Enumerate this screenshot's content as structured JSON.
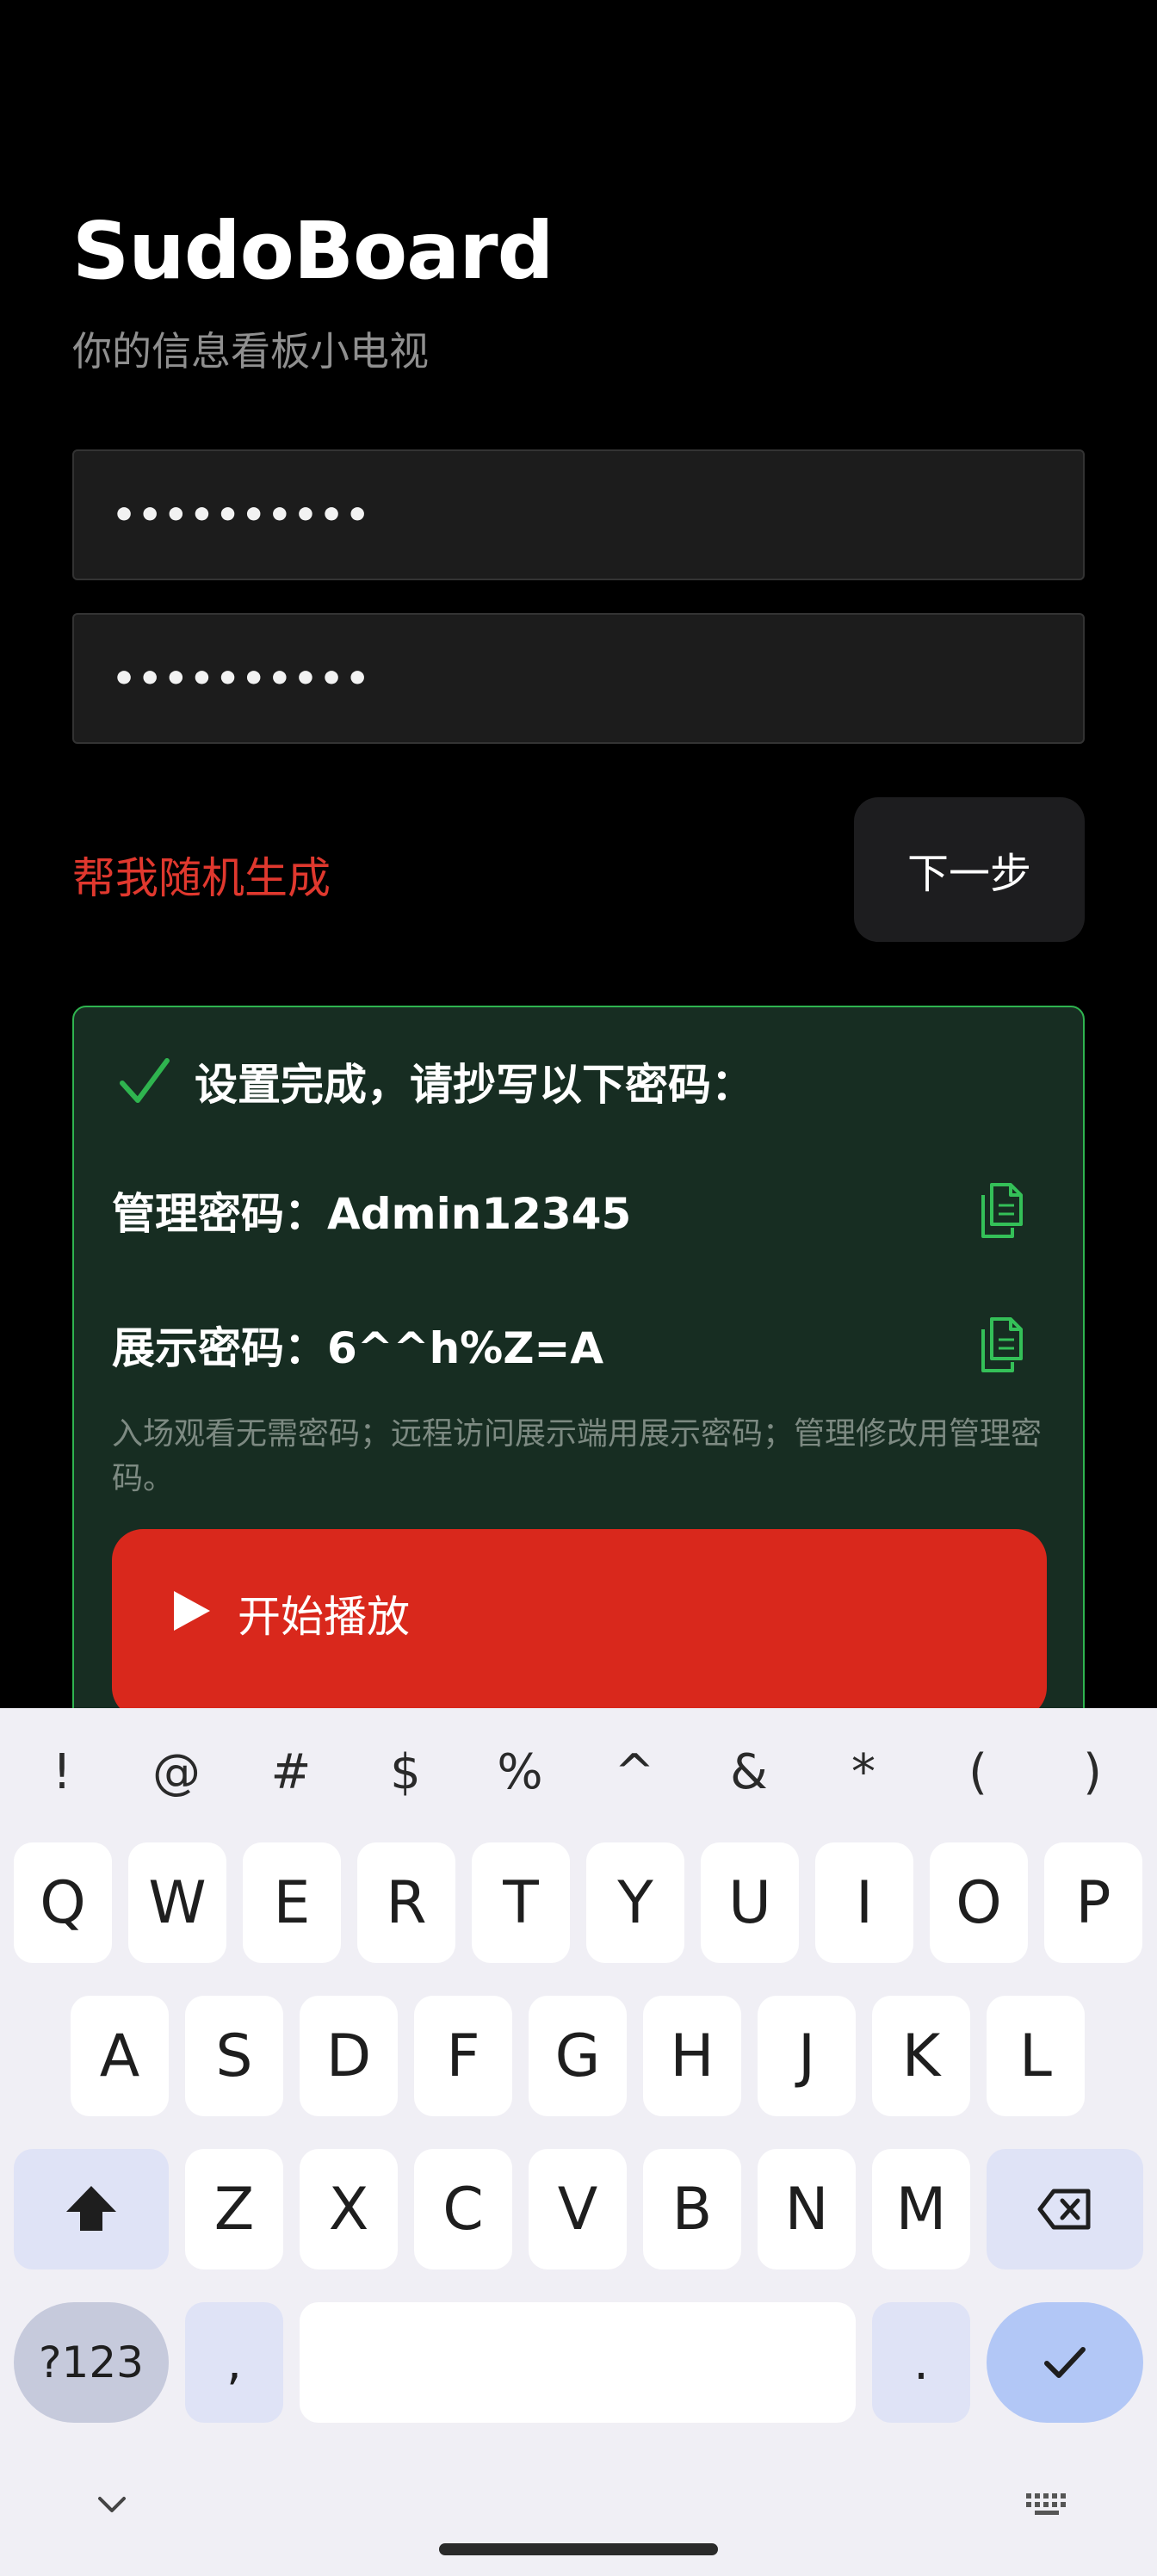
{
  "app": {
    "title": "SudoBoard",
    "subtitle": "你的信息看板小电视"
  },
  "form": {
    "password_masked": "••••••••••",
    "confirm_masked": "••••••••••",
    "generate_link": "帮我随机生成",
    "next_button": "下一步"
  },
  "result": {
    "heading": "设置完成，请抄写以下密码：",
    "admin_password": "管理密码：Admin12345",
    "display_password": "展示密码：6^^h%Z=A",
    "note": "入场观看无需密码；远程访问展示端用展示密码；管理修改用管理密码。",
    "start_button": "开始播放"
  },
  "keyboard": {
    "symbols": [
      "!",
      "@",
      "#",
      "$",
      "%",
      "^",
      "&",
      "*",
      "(",
      ")"
    ],
    "row1": [
      "Q",
      "W",
      "E",
      "R",
      "T",
      "Y",
      "U",
      "I",
      "O",
      "P"
    ],
    "row2": [
      "A",
      "S",
      "D",
      "F",
      "G",
      "H",
      "J",
      "K",
      "L"
    ],
    "row3": [
      "Z",
      "X",
      "C",
      "V",
      "B",
      "N",
      "M"
    ],
    "num_key": "?123",
    "comma_key": ",",
    "period_key": "."
  },
  "colors": {
    "accent_red": "#d9281c",
    "success_green": "#2fb44f",
    "panel_bg": "#172d22"
  }
}
